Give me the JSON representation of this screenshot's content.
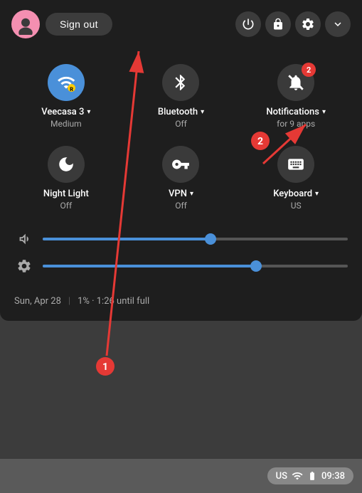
{
  "header": {
    "signout_label": "Sign out",
    "power_icon": "power",
    "lock_icon": "lock",
    "settings_icon": "settings",
    "chevron_icon": "chevron-down"
  },
  "quick_tiles": [
    {
      "id": "wifi",
      "label": "Veecasa 3",
      "sub": "Medium",
      "active": true,
      "has_dropdown": true,
      "badge": null
    },
    {
      "id": "bluetooth",
      "label": "Bluetooth",
      "sub": "Off",
      "active": false,
      "has_dropdown": true,
      "badge": null
    },
    {
      "id": "notifications",
      "label": "Notifications",
      "sub": "for 9 apps",
      "active": false,
      "has_dropdown": true,
      "badge": "2"
    },
    {
      "id": "nightlight",
      "label": "Night Light",
      "sub": "Off",
      "active": false,
      "has_dropdown": false,
      "badge": null
    },
    {
      "id": "vpn",
      "label": "VPN",
      "sub": "Off",
      "active": false,
      "has_dropdown": true,
      "badge": null
    },
    {
      "id": "keyboard",
      "label": "Keyboard",
      "sub": "US",
      "active": false,
      "has_dropdown": true,
      "badge": null
    }
  ],
  "sliders": {
    "volume_percent": 55,
    "brightness_percent": 70
  },
  "status_bar": {
    "date": "Sun, Apr 28",
    "battery": "1% · 1:26 until full",
    "keyboard_layout": "US",
    "time": "09:38"
  },
  "annotations": {
    "circle1_label": "1",
    "circle2_label": "2"
  }
}
